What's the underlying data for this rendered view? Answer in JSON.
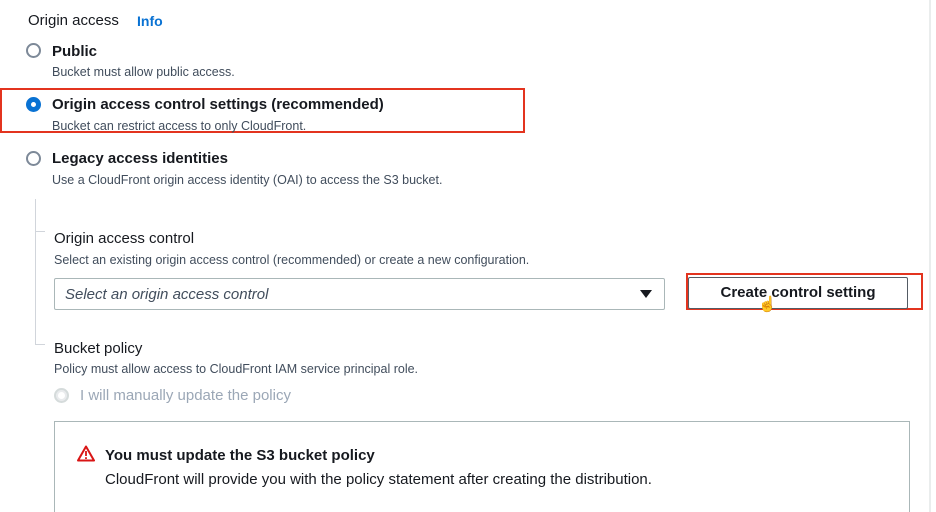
{
  "origin_access": {
    "label": "Origin access",
    "info_link": "Info",
    "options": [
      {
        "label": "Public",
        "description": "Bucket must allow public access.",
        "selected": false
      },
      {
        "label": "Origin access control settings (recommended)",
        "description": "Bucket can restrict access to only CloudFront.",
        "selected": true
      },
      {
        "label": "Legacy access identities",
        "description": "Use a CloudFront origin access identity (OAI) to access the S3 bucket.",
        "selected": false
      }
    ]
  },
  "origin_access_control": {
    "title": "Origin access control",
    "description": "Select an existing origin access control (recommended) or create a new configuration.",
    "select_placeholder": "Select an origin access control",
    "create_button": "Create control setting"
  },
  "bucket_policy": {
    "title": "Bucket policy",
    "description": "Policy must allow access to CloudFront IAM service principal role.",
    "option_label": "I will manually update the policy"
  },
  "alert": {
    "title": "You must update the S3 bucket policy",
    "body": "CloudFront will provide you with the policy statement after creating the distribution."
  },
  "colors": {
    "accent": "#0972d3",
    "highlight": "#e3341f",
    "warning": "#d91515"
  }
}
